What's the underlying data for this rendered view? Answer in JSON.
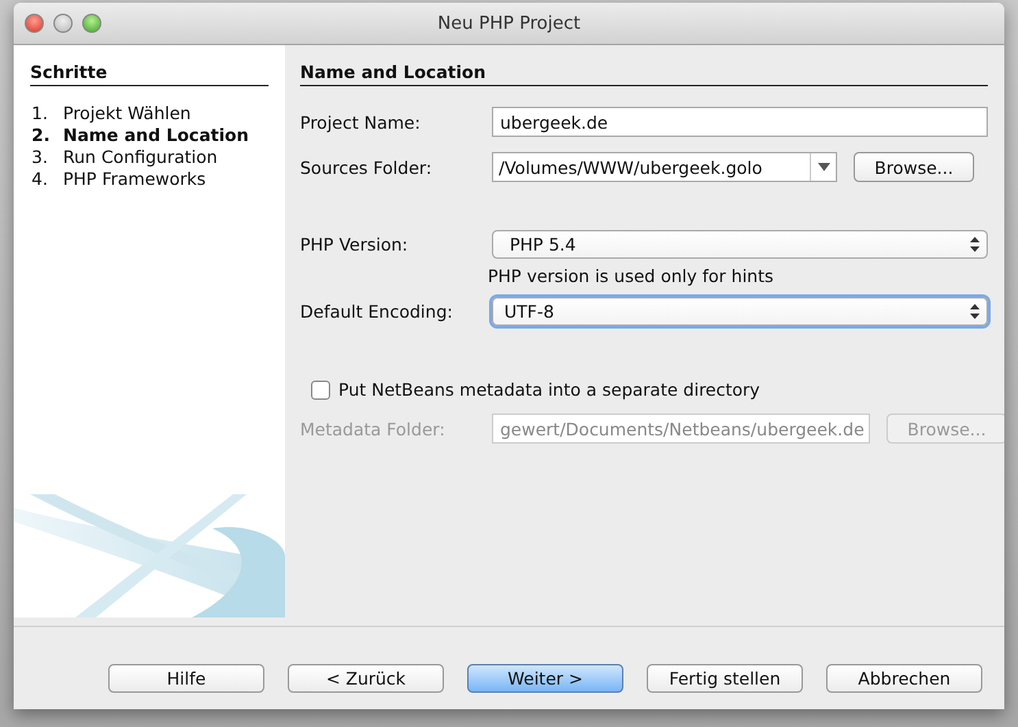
{
  "window": {
    "title": "Neu PHP Project"
  },
  "sidebar": {
    "title": "Schritte",
    "steps": [
      {
        "number": "1.",
        "label": "Projekt Wählen",
        "selected": false
      },
      {
        "number": "2.",
        "label": "Name and Location",
        "selected": true
      },
      {
        "number": "3.",
        "label": "Run Configuration",
        "selected": false
      },
      {
        "number": "4.",
        "label": "PHP Frameworks",
        "selected": false
      }
    ]
  },
  "panel": {
    "title": "Name and Location",
    "project_name": {
      "label": "Project Name:",
      "value": "ubergeek.de"
    },
    "sources_folder": {
      "label": "Sources Folder:",
      "value": "/Volumes/WWW/ubergeek.golo",
      "button": "Browse..."
    },
    "php_version": {
      "label": "PHP Version:",
      "value": "PHP 5.4",
      "hint": "PHP version is used only for hints"
    },
    "encoding": {
      "label": "Default Encoding:",
      "value": "UTF-8",
      "focused": true
    },
    "metadata_checkbox": {
      "label": "Put NetBeans metadata into a separate directory",
      "checked": false
    },
    "metadata_folder": {
      "label": "Metadata Folder:",
      "value": "gewert/Documents/Netbeans/ubergeek.de",
      "button": "Browse...",
      "disabled": true
    }
  },
  "buttons": [
    {
      "label": "Hilfe",
      "kind": "normal"
    },
    {
      "label": "< Zurück",
      "kind": "normal"
    },
    {
      "label": "Weiter >",
      "kind": "primary"
    },
    {
      "label": "Fertig stellen",
      "kind": "normal"
    },
    {
      "label": "Abbrechen",
      "kind": "normal"
    }
  ]
}
